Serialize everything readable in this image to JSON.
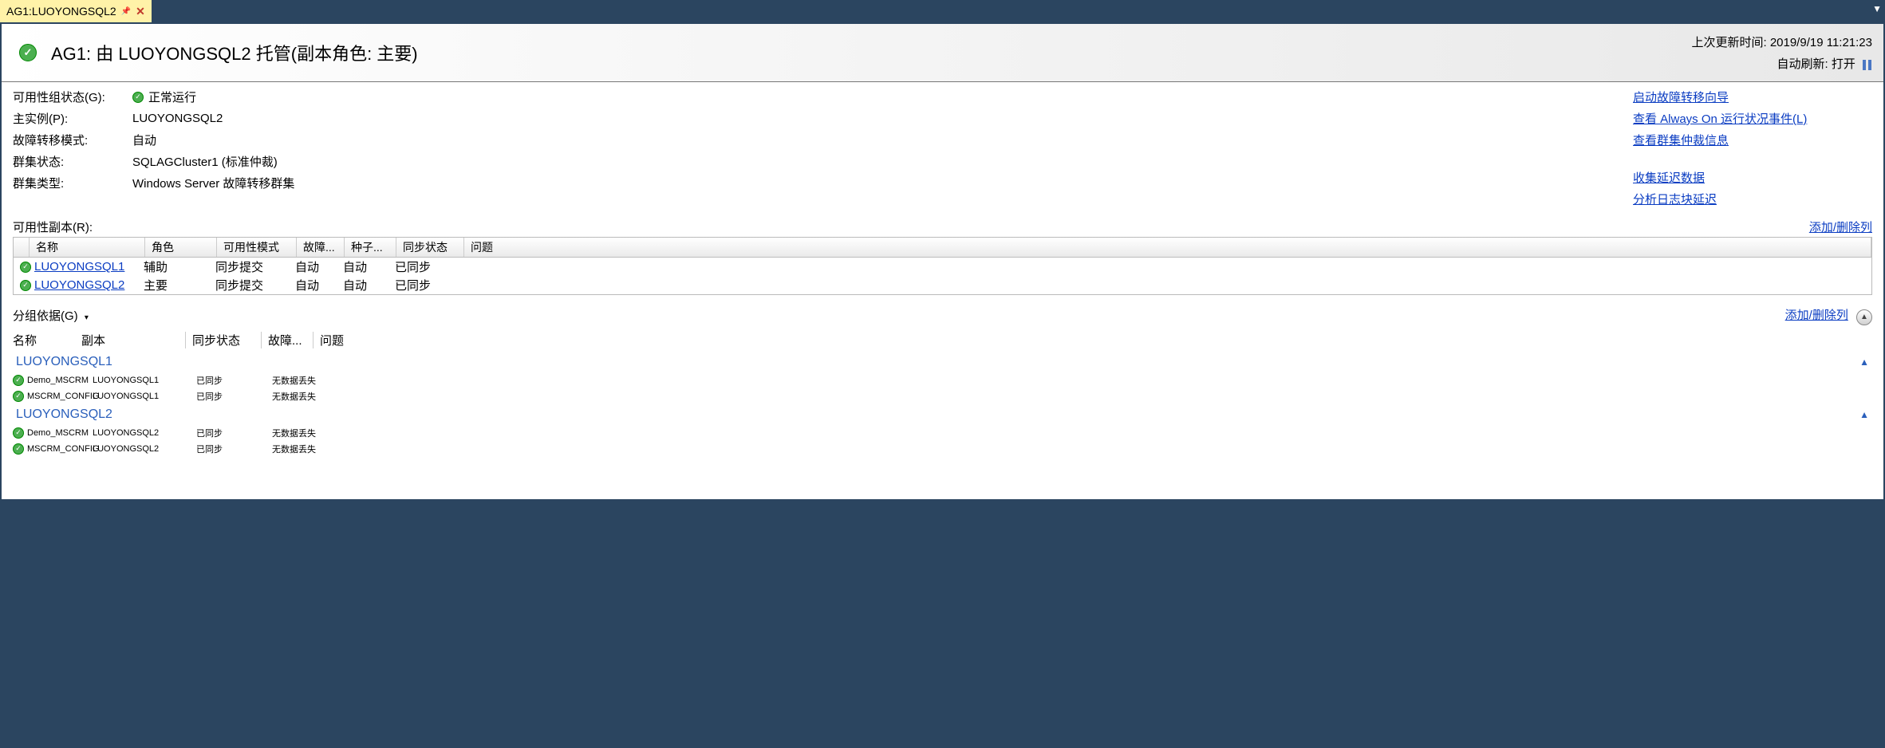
{
  "tab": {
    "title": "AG1:LUOYONGSQL2"
  },
  "header": {
    "title": "AG1: 由 LUOYONGSQL2 托管(副本角色: 主要)",
    "last_update_label": "上次更新时间:",
    "last_update_value": "2019/9/19 11:21:23",
    "auto_refresh_label": "自动刷新:",
    "auto_refresh_value": "打开"
  },
  "kv": {
    "state_label": "可用性组状态(G):",
    "state_value": "正常运行",
    "primary_label": "主实例(P):",
    "primary_value": "LUOYONGSQL2",
    "failover_label": "故障转移模式:",
    "failover_value": "自动",
    "cluster_state_label": "群集状态:",
    "cluster_state_value": "SQLAGCluster1 (标准仲裁)",
    "cluster_type_label": "群集类型:",
    "cluster_type_value": "Windows Server 故障转移群集"
  },
  "actions": {
    "a1": "启动故障转移向导",
    "a2": "查看 Always On 运行状况事件(L)",
    "a3": "查看群集仲裁信息",
    "a4": "收集延迟数据",
    "a5": "分析日志块延迟"
  },
  "replicas": {
    "title": "可用性副本(R):",
    "addrem": "添加/删除列",
    "cols": {
      "name": "名称",
      "role": "角色",
      "avail": "可用性模式",
      "fail": "故障...",
      "seed": "种子...",
      "sync": "同步状态",
      "issue": "问题"
    },
    "rows": [
      {
        "name": "LUOYONGSQL1",
        "role": "辅助",
        "avail": "同步提交",
        "fail": "自动",
        "seed": "自动",
        "sync": "已同步"
      },
      {
        "name": "LUOYONGSQL2",
        "role": "主要",
        "avail": "同步提交",
        "fail": "自动",
        "seed": "自动",
        "sync": "已同步"
      }
    ]
  },
  "dbsection": {
    "groupby": "分组依据(G)",
    "addrem": "添加/删除列",
    "cols": {
      "name": "名称",
      "rep": "副本",
      "sync": "同步状态",
      "fail": "故障...",
      "issue": "问题"
    },
    "groups": [
      {
        "title": "LUOYONGSQL1",
        "rows": [
          {
            "name": "Demo_MSCRM",
            "rep": "LUOYONGSQL1",
            "sync": "已同步",
            "fail": "无数据丢失"
          },
          {
            "name": "MSCRM_CONFIG",
            "rep": "LUOYONGSQL1",
            "sync": "已同步",
            "fail": "无数据丢失"
          }
        ]
      },
      {
        "title": "LUOYONGSQL2",
        "rows": [
          {
            "name": "Demo_MSCRM",
            "rep": "LUOYONGSQL2",
            "sync": "已同步",
            "fail": "无数据丢失"
          },
          {
            "name": "MSCRM_CONFIG",
            "rep": "LUOYONGSQL2",
            "sync": "已同步",
            "fail": "无数据丢失"
          }
        ]
      }
    ]
  }
}
